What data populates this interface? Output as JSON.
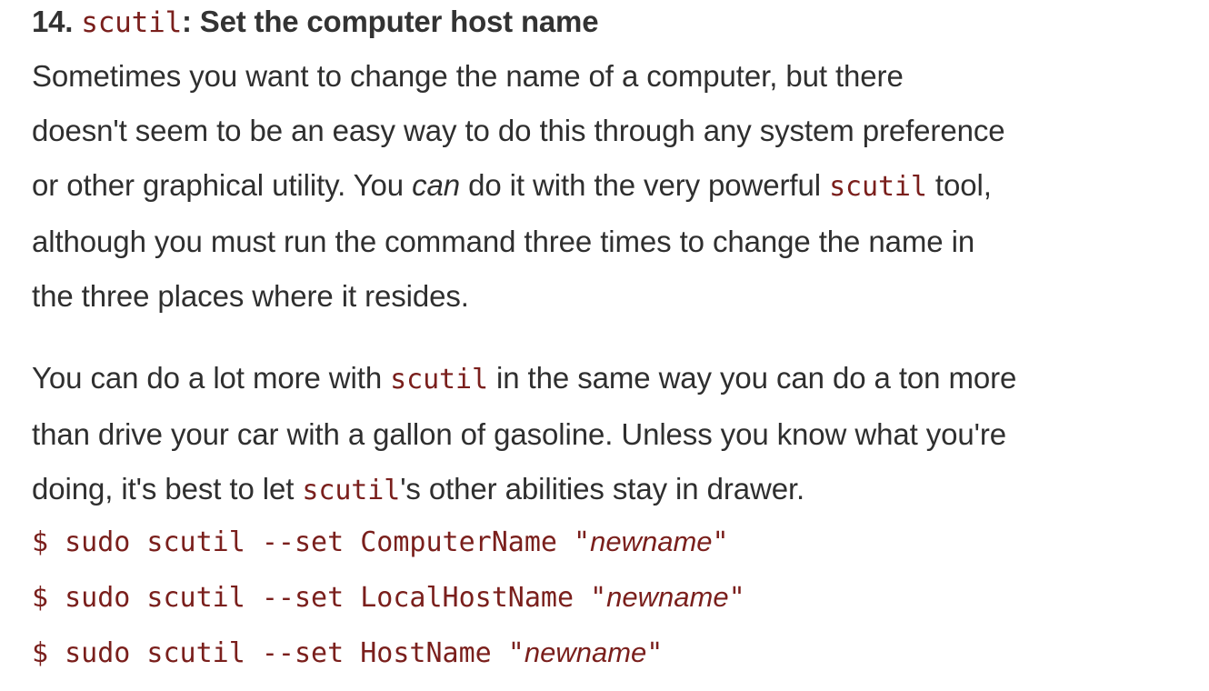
{
  "section": {
    "number": "14.",
    "command": "scutil",
    "title_rest": ": Set the computer host name"
  },
  "para1": {
    "line1": "Sometimes you want to change the name of a computer, but there",
    "line2": "doesn't seem to be an easy way to do this through any system preference",
    "line3_a": "or other graphical utility. You ",
    "line3_em": "can",
    "line3_b": " do it with the very powerful ",
    "line3_code": "scutil",
    "line3_c": " tool,",
    "line4": "although you must run the command three times to change the name in",
    "line5": "the three places where it resides."
  },
  "para2": {
    "line1_a": "You can do a lot more with ",
    "line1_code": "scutil",
    "line1_b": " in the same way you can do a ton more",
    "line2": "than drive your car with a gallon of gasoline. Unless you know what you're",
    "line3_a": "doing, it's best to let ",
    "line3_code": "scutil",
    "line3_b": "'s other abilities stay in drawer."
  },
  "commands": [
    {
      "prefix": "$ sudo scutil --set ComputerName \"",
      "arg": "newname",
      "suffix": "\""
    },
    {
      "prefix": "$ sudo scutil --set LocalHostName \"",
      "arg": "newname",
      "suffix": "\""
    },
    {
      "prefix": "$ sudo scutil --set HostName \"",
      "arg": "newname",
      "suffix": "\""
    }
  ],
  "colors": {
    "body_text": "#2f2f2f",
    "code_text": "#7a1f1c",
    "background": "#ffffff"
  }
}
